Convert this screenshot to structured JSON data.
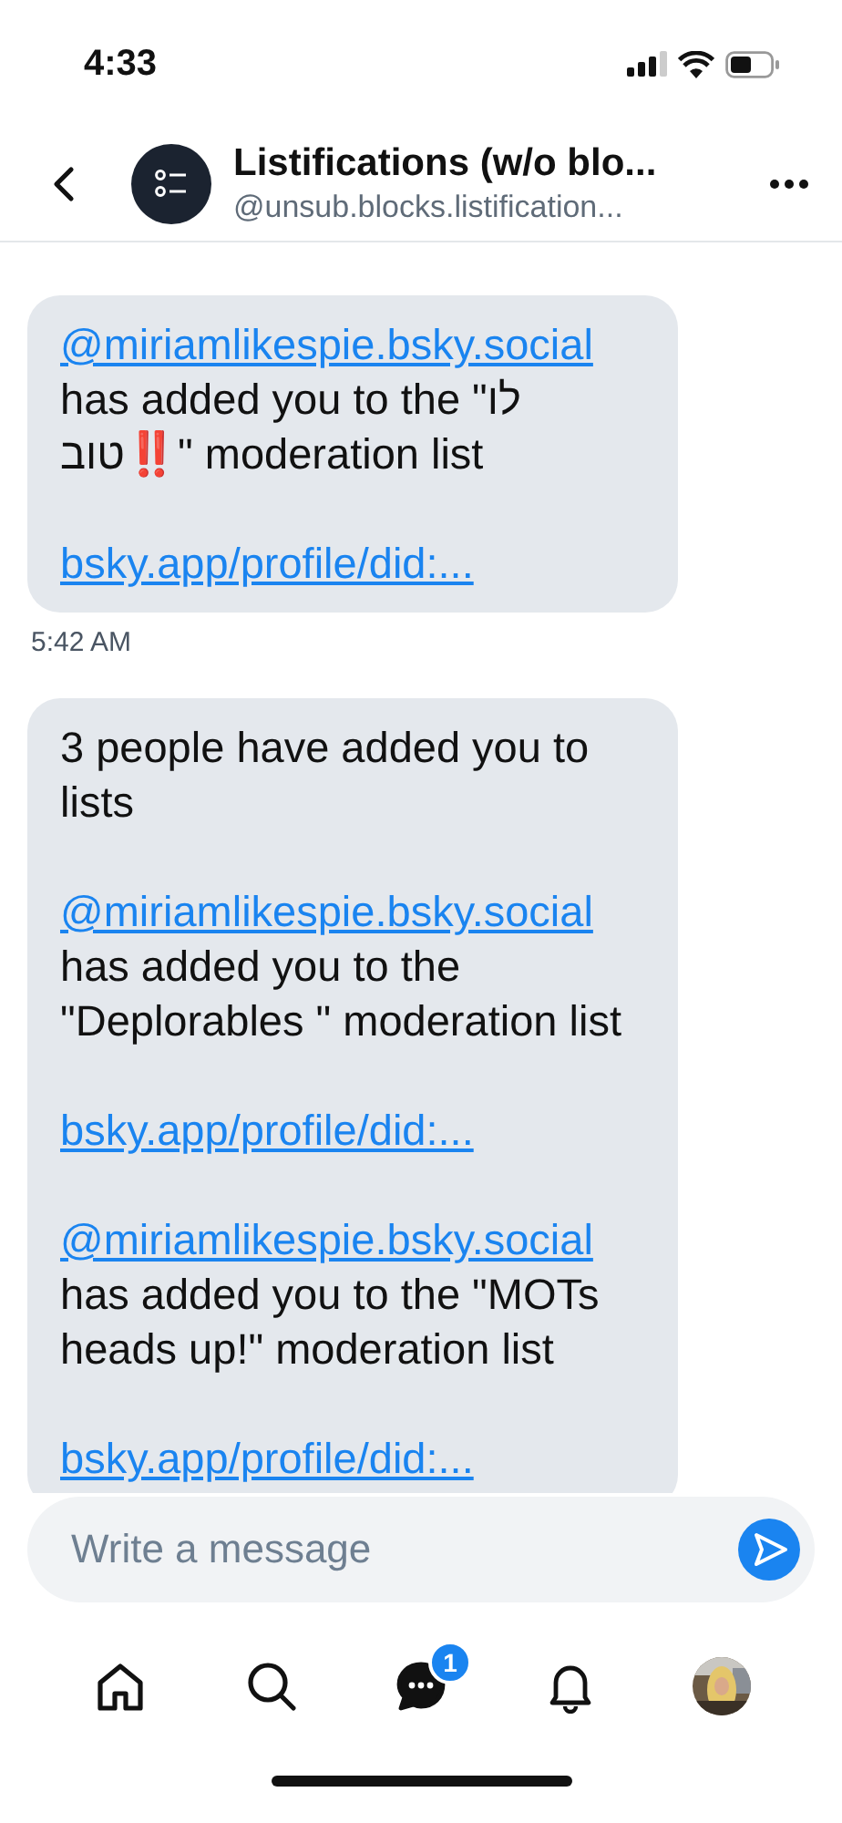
{
  "status_bar": {
    "time": "4:33"
  },
  "header": {
    "title": "Listifications (w/o blo...",
    "handle": "@unsub.blocks.listification..."
  },
  "messages": [
    {
      "paragraphs": [
        [
          {
            "kind": "link",
            "text": "@miriamlikespie.bsky.social"
          },
          {
            "kind": "text",
            "text": "has added you to the \"לו טוב‼️\" moderation list"
          }
        ],
        [
          {
            "kind": "link",
            "text": "bsky.app/profile/did:..."
          }
        ]
      ],
      "time": "5:42 AM"
    },
    {
      "paragraphs": [
        [
          {
            "kind": "text",
            "text": "3 people have added you to lists"
          }
        ],
        [
          {
            "kind": "link",
            "text": "@miriamlikespie.bsky.social"
          },
          {
            "kind": "text",
            "text": "has added you to the \"Deplorables \" moderation list"
          }
        ],
        [
          {
            "kind": "link",
            "text": "bsky.app/profile/did:..."
          }
        ],
        [
          {
            "kind": "link",
            "text": "@miriamlikespie.bsky.social"
          },
          {
            "kind": "text",
            "text": "has added you to the \"MOTs heads up!\" moderation list"
          }
        ],
        [
          {
            "kind": "link",
            "text": "bsky.app/profile/did:..."
          }
        ]
      ]
    }
  ],
  "composer": {
    "placeholder": "Write a message"
  },
  "nav": [
    {
      "kind": "home",
      "selected": false
    },
    {
      "kind": "search",
      "selected": false
    },
    {
      "kind": "chat",
      "selected": true,
      "badge": "1"
    },
    {
      "kind": "bell",
      "selected": false
    },
    {
      "kind": "profile",
      "selected": false
    }
  ]
}
